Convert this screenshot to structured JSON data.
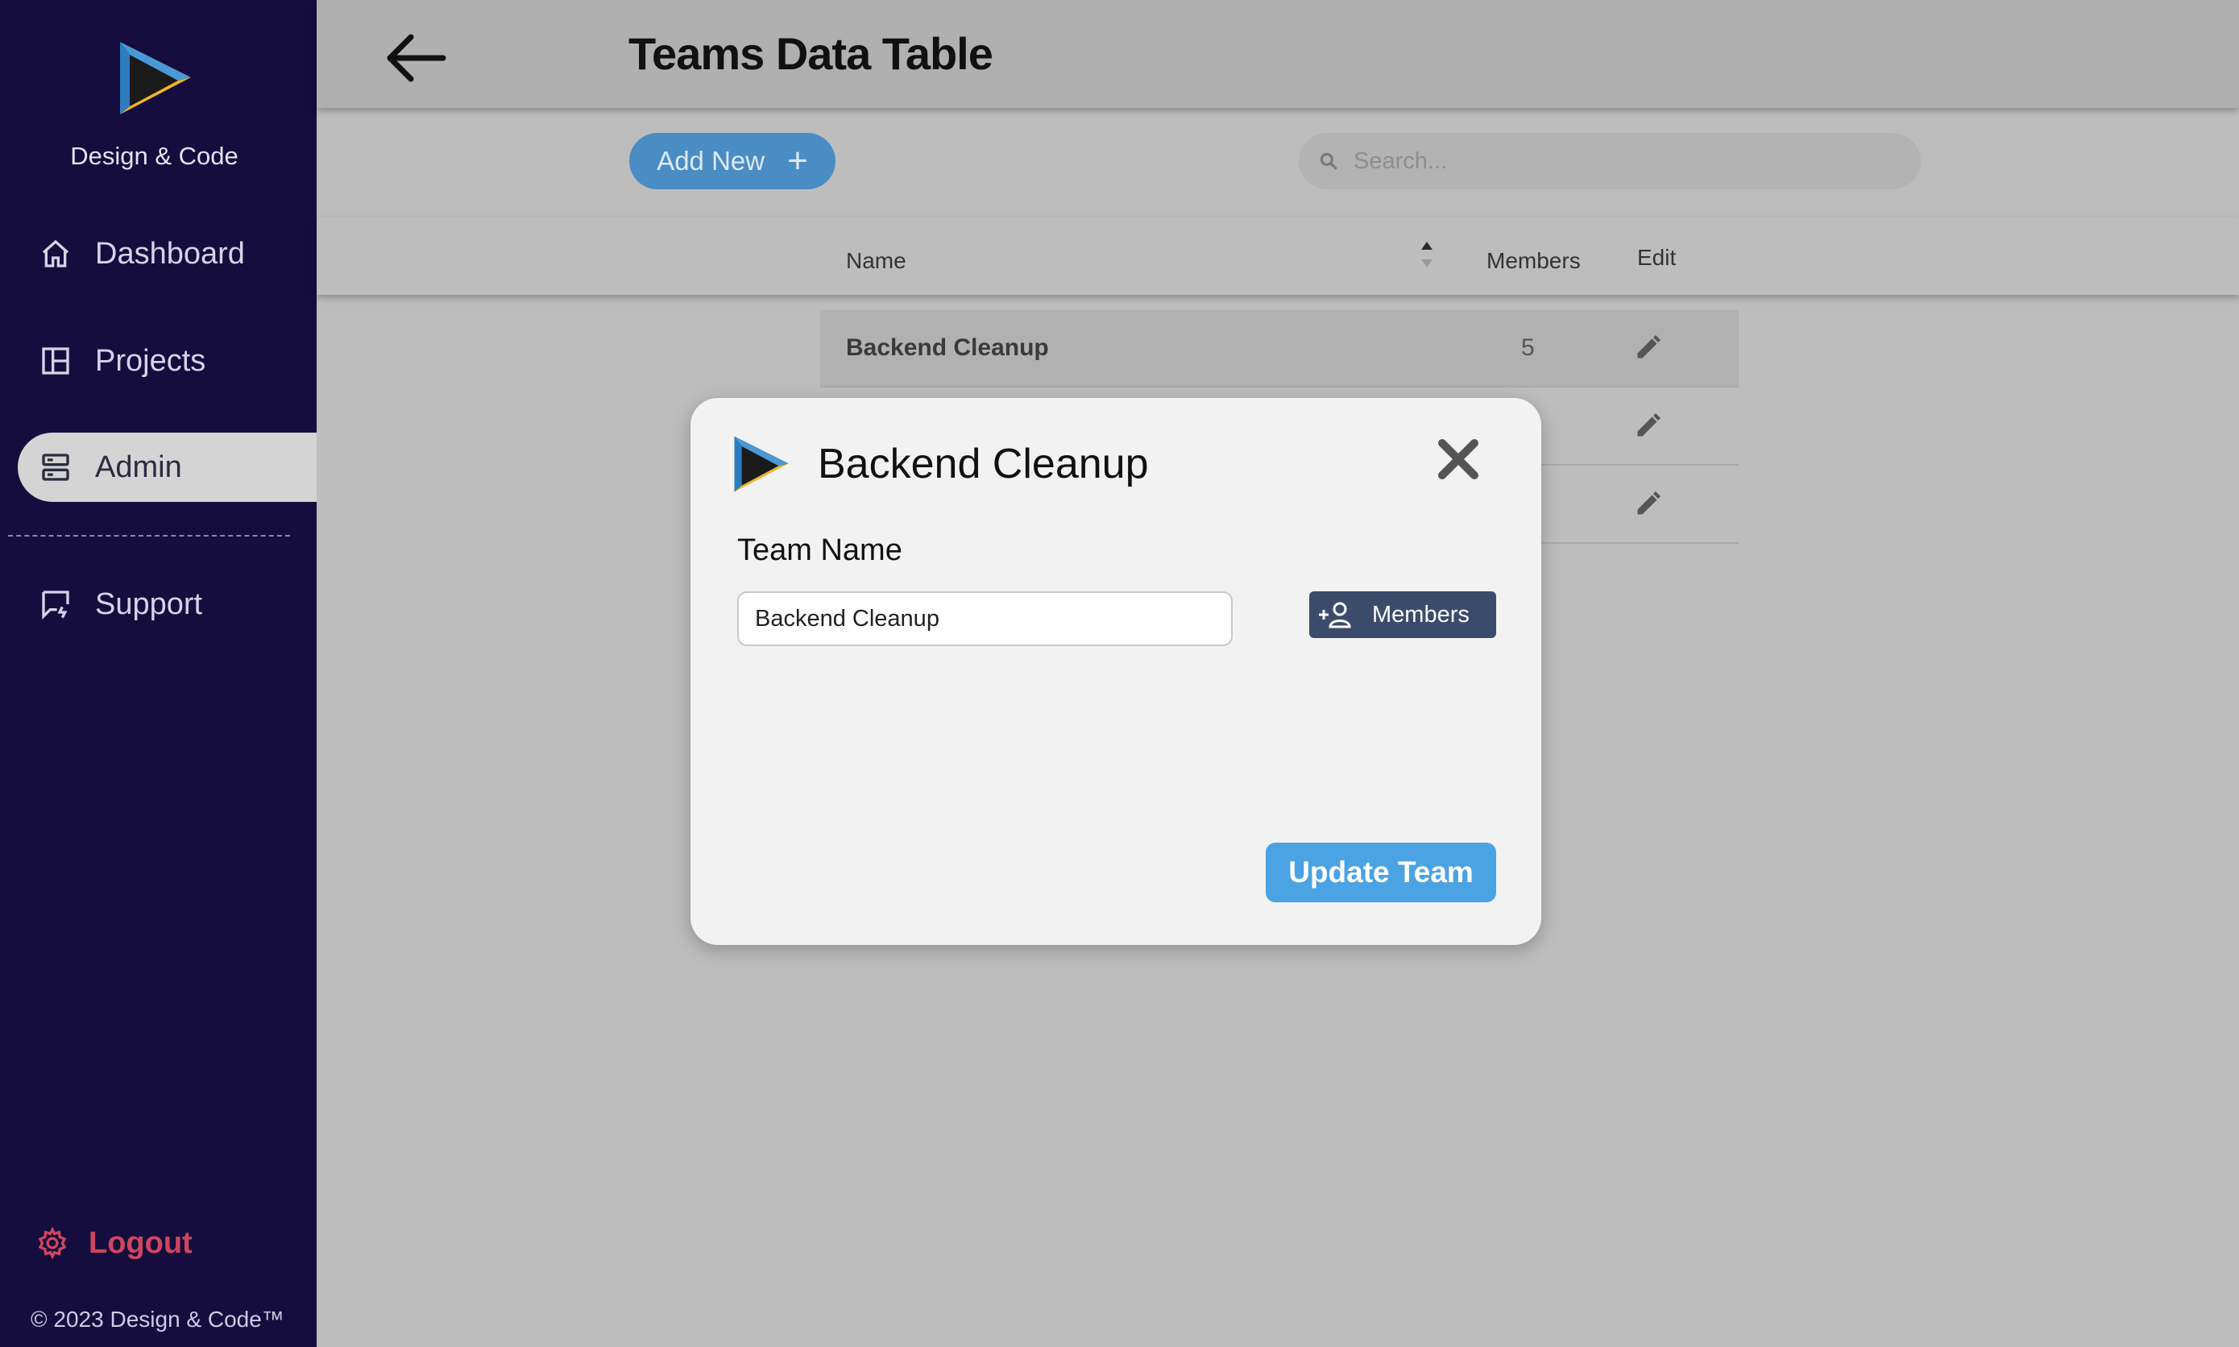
{
  "app": {
    "brand_name": "Design & Code",
    "copyright": "© 2023 Design & Code™",
    "colors": {
      "sidebar": "#140d3e",
      "accent": "#4ba3e3",
      "logout": "#d0455e"
    }
  },
  "sidebar": {
    "items": [
      {
        "label": "Dashboard",
        "icon": "home-icon"
      },
      {
        "label": "Projects",
        "icon": "layout-icon"
      },
      {
        "label": "Admin",
        "icon": "server-icon",
        "active": true
      },
      {
        "label": "Support",
        "icon": "chat-icon"
      }
    ],
    "logout_label": "Logout"
  },
  "header": {
    "title": "Teams Data Table"
  },
  "toolbar": {
    "add_label": "Add New",
    "search_placeholder": "Search..."
  },
  "table": {
    "columns": {
      "name": "Name",
      "members": "Members",
      "edit": "Edit"
    },
    "rows": [
      {
        "name": "Backend Cleanup",
        "members": "5"
      },
      {
        "name": "",
        "members": ""
      },
      {
        "name": "",
        "members": ""
      }
    ]
  },
  "modal": {
    "title": "Backend Cleanup",
    "field_label": "Team Name",
    "team_name_value": "Backend Cleanup",
    "members_label": "Members",
    "update_label": "Update Team"
  }
}
